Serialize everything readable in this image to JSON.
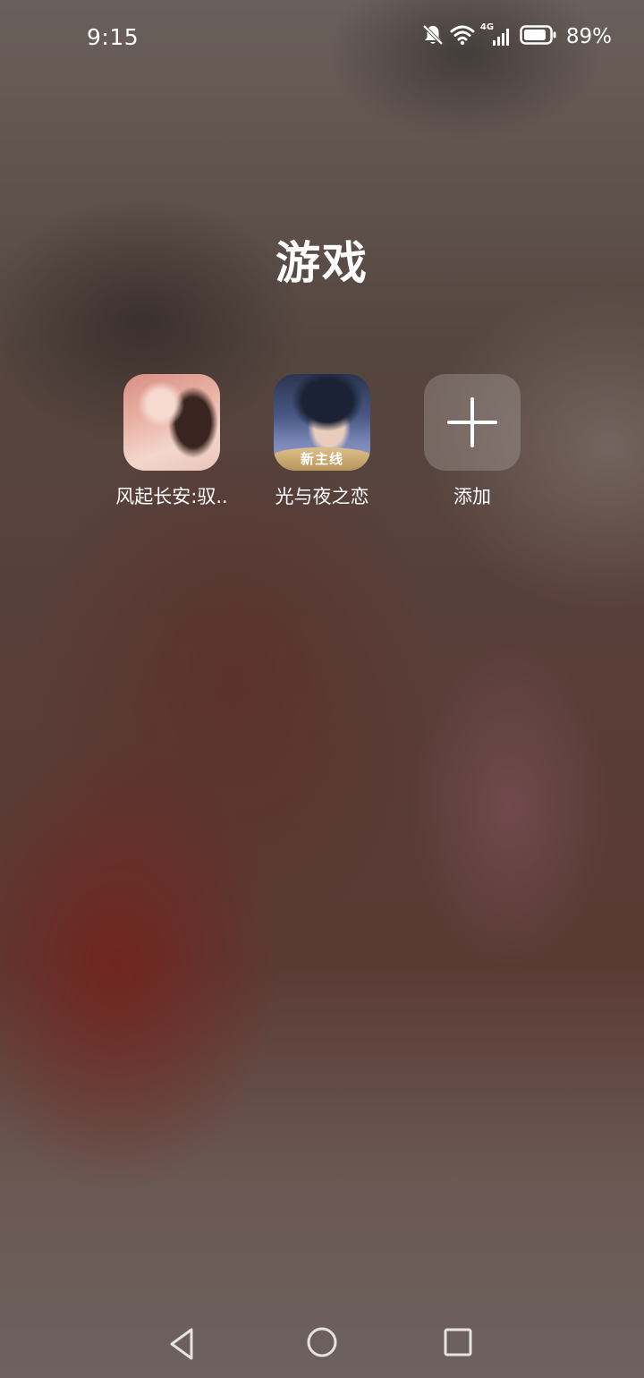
{
  "status_bar": {
    "time": "9:15",
    "network_type": "4G",
    "battery_percent": "89%",
    "battery_level": 0.89,
    "icons": [
      "bell-muted-icon",
      "wifi-icon",
      "cellular-signal-icon",
      "battery-icon"
    ]
  },
  "folder": {
    "title": "游戏",
    "apps": [
      {
        "label": "风起长安:驭..",
        "icon": "game-app-icon"
      },
      {
        "label": "光与夜之恋",
        "icon": "game-app-icon",
        "badge": "新主线"
      },
      {
        "label": "添加",
        "icon": "plus-icon"
      }
    ]
  },
  "nav_bar": {
    "buttons": [
      "back-icon",
      "home-icon",
      "recents-icon"
    ]
  }
}
